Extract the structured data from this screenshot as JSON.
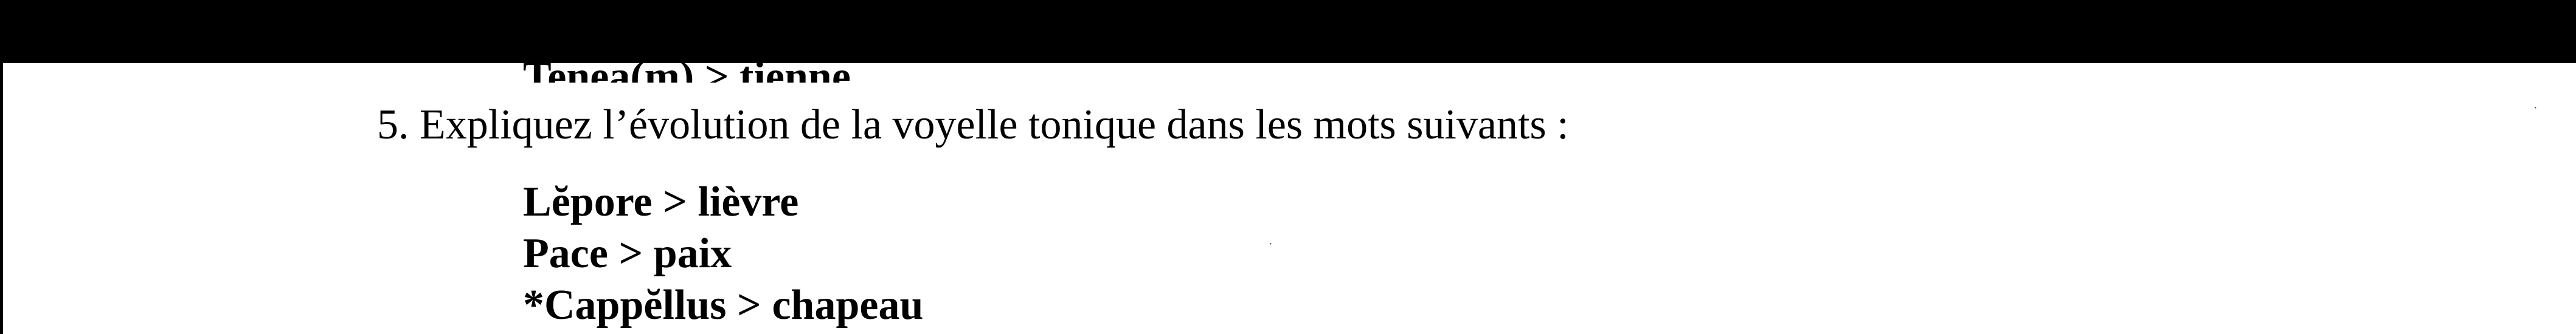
{
  "document": {
    "cut_line": "Tenea(m) > tienne",
    "question": "5. Expliquez l’évolution de la voyelle tonique dans les mots suivants :",
    "words": [
      "Lĕpore > lièvre",
      "Pace > paix",
      "*Cappĕllus > chapeau"
    ]
  }
}
